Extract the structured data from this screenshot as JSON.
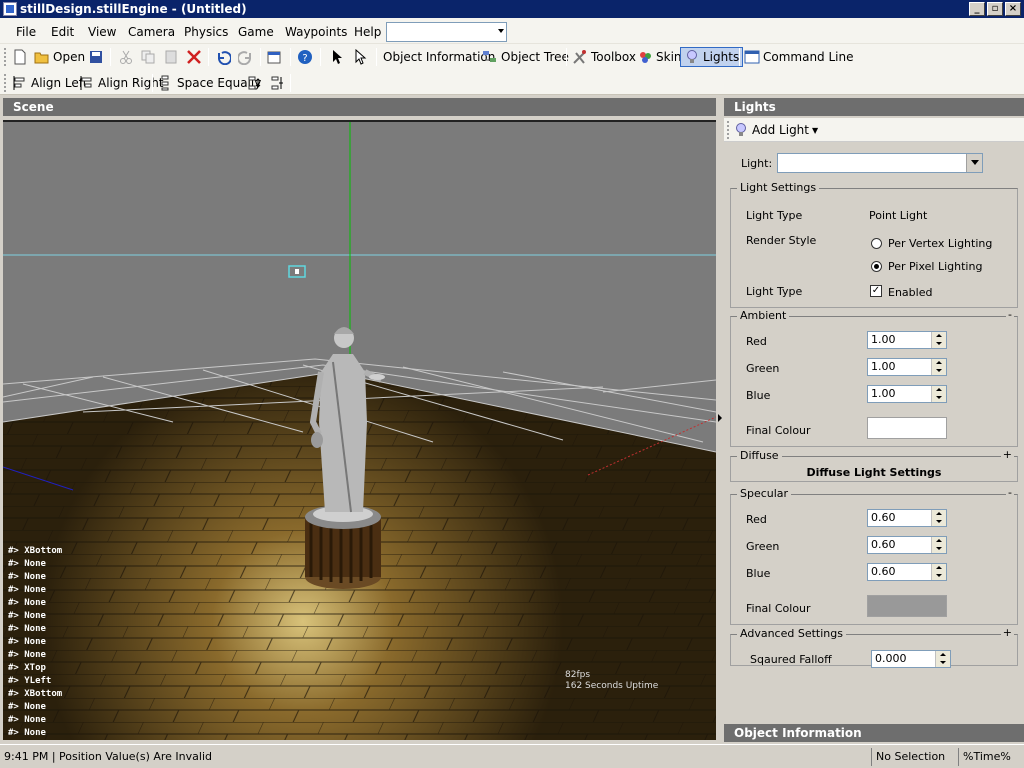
{
  "window": {
    "title": "stillDesign.stillEngine - (Untitled)",
    "min": "_",
    "max": "▫",
    "close": "×"
  },
  "menu": {
    "items": [
      "File",
      "Edit",
      "View",
      "Camera",
      "Physics",
      "Game",
      "Waypoints",
      "Help"
    ]
  },
  "toolbar1": {
    "open": "Open",
    "object_information": "Object Information",
    "object_tree": "Object Tree",
    "toolbox": "Toolbox",
    "skin": "Skin",
    "lights": "Lights",
    "command_line": "Command Line"
  },
  "toolbar2": {
    "align_left": "Align Left",
    "align_right": "Align Right",
    "space_equally": "Space Equally"
  },
  "scene": {
    "title": "Scene",
    "console": [
      "#> XBottom",
      "#> None",
      "#> None",
      "#> None",
      "#> None",
      "#> None",
      "#> None",
      "#> None",
      "#> None",
      "#> XTop",
      "#> YLeft",
      "#> XBottom",
      "#> None",
      "#> None",
      "#> None"
    ],
    "fps": "82fps",
    "uptime": "162 Seconds Uptime"
  },
  "lights_panel": {
    "title": "Lights",
    "add_light": "Add Light",
    "light_label": "Light:",
    "light_value": "",
    "settings": {
      "group": "Light Settings",
      "light_type_label": "Light Type",
      "light_type_value": "Point Light",
      "render_style_label": "Render Style",
      "per_vertex": "Per Vertex Lighting",
      "per_pixel": "Per Pixel Lighting",
      "render_style_selected": "Per Pixel Lighting",
      "enabled_row_label": "Light Type",
      "enabled_label": "Enabled",
      "enabled_mark": "✓"
    },
    "ambient": {
      "group": "Ambient",
      "toggle": "-",
      "red_label": "Red",
      "red": "1.00",
      "green_label": "Green",
      "green": "1.00",
      "blue_label": "Blue",
      "blue": "1.00",
      "final_label": "Final Colour",
      "final_color": "#ffffff"
    },
    "diffuse": {
      "group": "Diffuse",
      "toggle": "+",
      "button": "Diffuse Light Settings"
    },
    "specular": {
      "group": "Specular",
      "toggle": "-",
      "red_label": "Red",
      "red": "0.60",
      "green_label": "Green",
      "green": "0.60",
      "blue_label": "Blue",
      "blue": "0.60",
      "final_label": "Final Colour",
      "final_color": "#999999"
    },
    "advanced": {
      "group": "Advanced Settings",
      "toggle": "+",
      "falloff_label": "Sqaured Falloff",
      "falloff": "0.000"
    }
  },
  "object_information": {
    "title": "Object Information"
  },
  "status": {
    "time_message": "9:41 PM | Position Value(s) Are Invalid",
    "selection": "No Selection",
    "time_pct": "%Time%"
  },
  "colors": {
    "titlebar": "#0a246a",
    "pane_header": "#6e6e6e",
    "axis_y": "#00c000",
    "axis_x": "#c03030",
    "axis_z": "#2020c0",
    "horizon": "#7fd0e0"
  }
}
